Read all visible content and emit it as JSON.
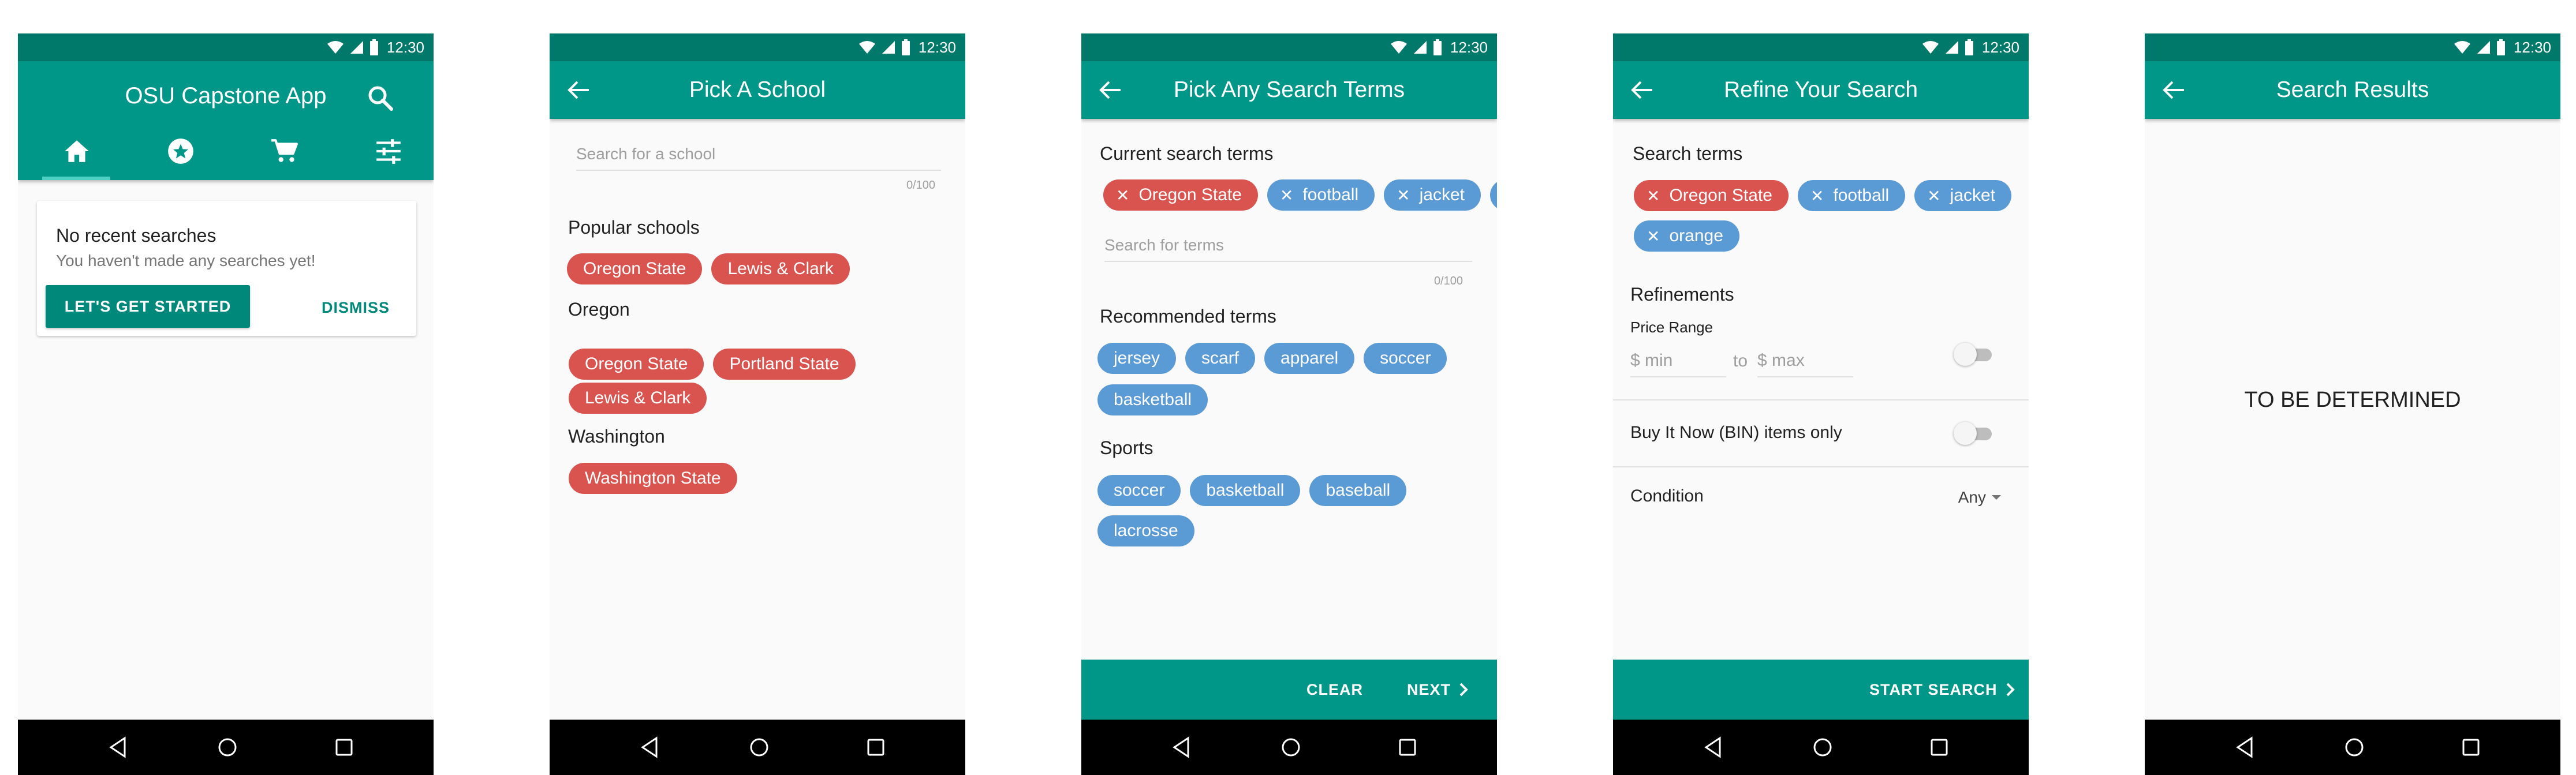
{
  "status_bar": {
    "time": "12:30"
  },
  "screen_home": {
    "title": "OSU Capstone App",
    "tabs": [
      "home",
      "favorites",
      "cart",
      "filters"
    ],
    "card": {
      "title": "No recent searches",
      "subtitle": "You haven't made any searches yet!",
      "primary": "LET'S GET STARTED",
      "secondary": "DISMISS"
    }
  },
  "screen_school": {
    "title": "Pick A School",
    "search": {
      "placeholder": "Search for a school",
      "counter": "0/100"
    },
    "popular_label": "Popular schools",
    "popular": [
      "Oregon State",
      "Lewis & Clark"
    ],
    "oregon_label": "Oregon",
    "oregon": [
      "Oregon State",
      "Portland State",
      "Lewis & Clark"
    ],
    "washington_label": "Washington",
    "washington": [
      "Washington State"
    ]
  },
  "screen_terms": {
    "title": "Pick Any Search Terms",
    "current_label": "Current search terms",
    "current": [
      "Oregon State",
      "football",
      "jacket"
    ],
    "search": {
      "placeholder": "Search for terms",
      "counter": "0/100"
    },
    "recommended_label": "Recommended terms",
    "recommended": [
      "jersey",
      "scarf",
      "apparel",
      "soccer",
      "basketball"
    ],
    "sports_label": "Sports",
    "sports": [
      "soccer",
      "basketball",
      "baseball",
      "lacrosse"
    ],
    "clear": "CLEAR",
    "next": "NEXT"
  },
  "screen_refine": {
    "title": "Refine Your Search",
    "terms_label": "Search terms",
    "terms": [
      "Oregon State",
      "football",
      "jacket",
      "orange"
    ],
    "refinements_label": "Refinements",
    "price_label": "Price Range",
    "min_placeholder": "$ min",
    "to": "to",
    "max_placeholder": "$ max",
    "bin_label": "Buy It Now (BIN) items only",
    "condition_label": "Condition",
    "condition_value": "Any",
    "start": "START SEARCH"
  },
  "screen_results": {
    "title": "Search Results",
    "placeholder": "TO BE DETERMINED"
  },
  "colors": {
    "status": "#00796b",
    "primary": "#009688",
    "school_chip": "#d9534f",
    "term_chip": "#5b9bd5"
  }
}
